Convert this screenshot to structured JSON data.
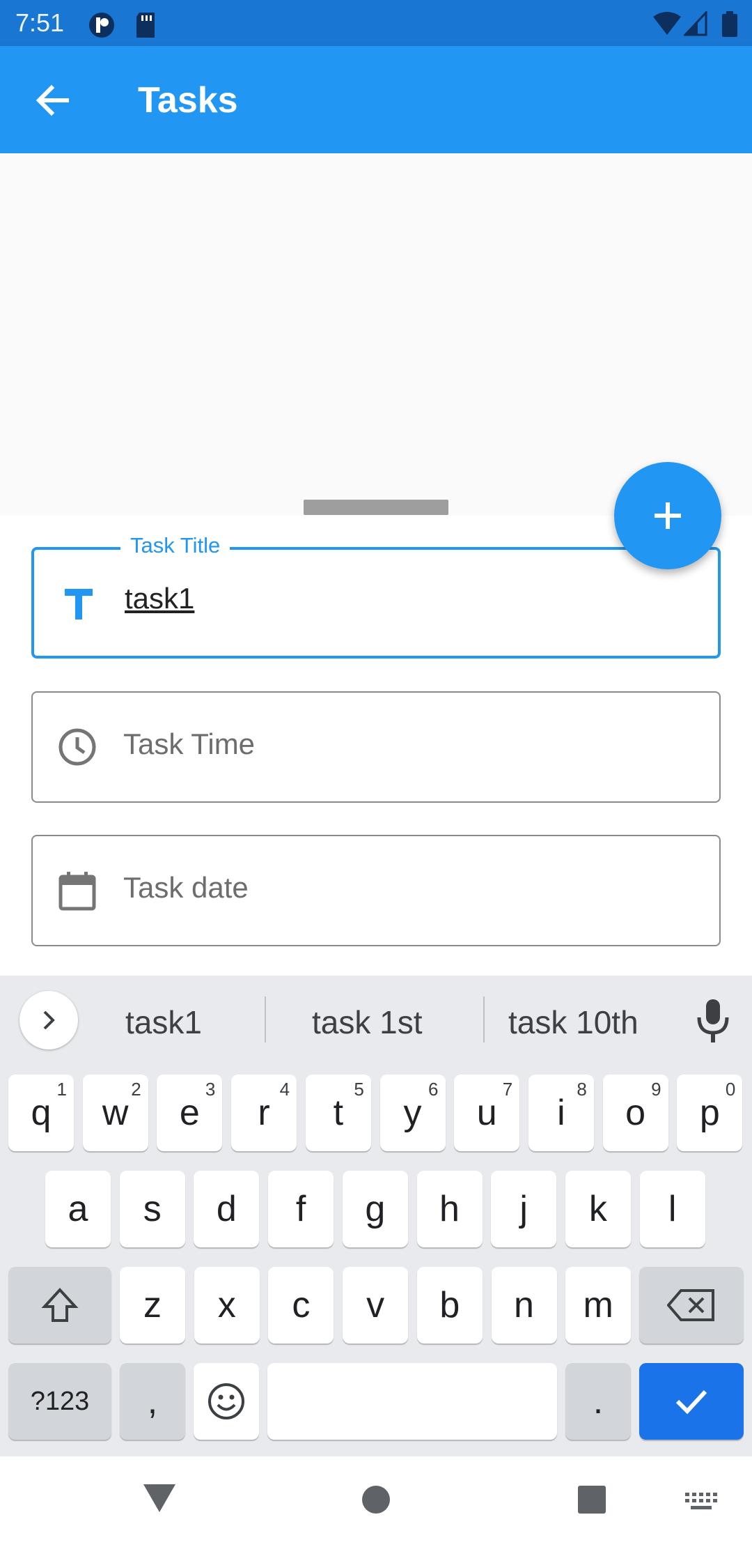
{
  "status_bar": {
    "time": "7:51"
  },
  "app_bar": {
    "title": "Tasks"
  },
  "form": {
    "title_field": {
      "label": "Task Title",
      "value": "task1"
    },
    "time_field": {
      "placeholder": "Task Time"
    },
    "date_field": {
      "placeholder": "Task date"
    }
  },
  "keyboard": {
    "suggestions": [
      "task1",
      "task 1st",
      "task 10th"
    ],
    "row1": [
      {
        "k": "q",
        "s": "1"
      },
      {
        "k": "w",
        "s": "2"
      },
      {
        "k": "e",
        "s": "3"
      },
      {
        "k": "r",
        "s": "4"
      },
      {
        "k": "t",
        "s": "5"
      },
      {
        "k": "y",
        "s": "6"
      },
      {
        "k": "u",
        "s": "7"
      },
      {
        "k": "i",
        "s": "8"
      },
      {
        "k": "o",
        "s": "9"
      },
      {
        "k": "p",
        "s": "0"
      }
    ],
    "row2": [
      "a",
      "s",
      "d",
      "f",
      "g",
      "h",
      "j",
      "k",
      "l"
    ],
    "row3": [
      "z",
      "x",
      "c",
      "v",
      "b",
      "n",
      "m"
    ],
    "symbols_label": "?123",
    "comma_label": ",",
    "period_label": "."
  },
  "colors": {
    "primary": "#2196f3",
    "status": "#1976d2",
    "action_key": "#1a73e8"
  }
}
